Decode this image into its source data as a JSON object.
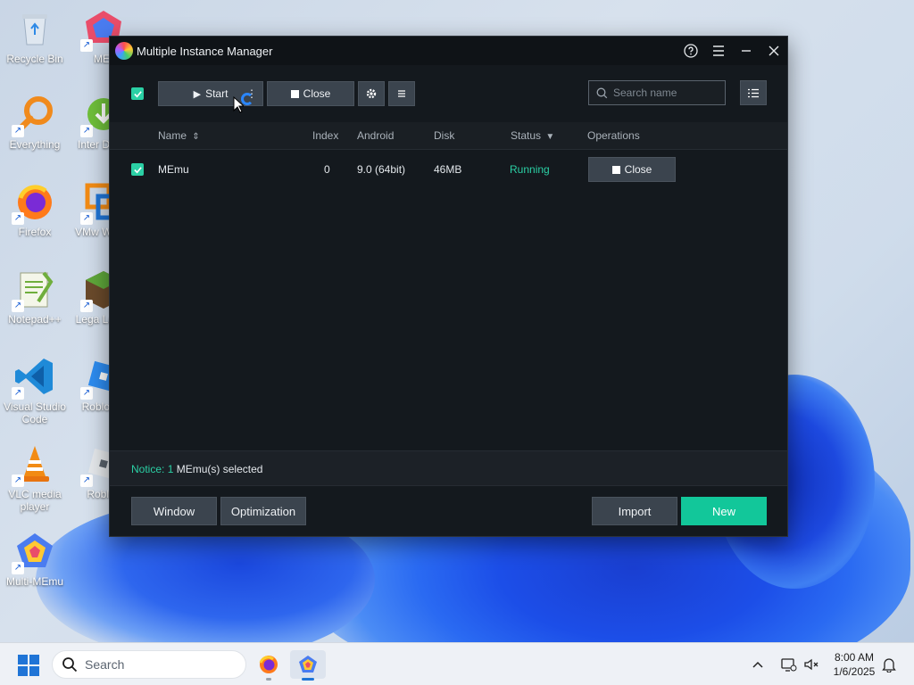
{
  "desktop": {
    "icons": [
      {
        "label": "Recycle Bin"
      },
      {
        "label": "Everything"
      },
      {
        "label": "Firefox"
      },
      {
        "label": "Notepad++"
      },
      {
        "label": "Visual Studio Code"
      },
      {
        "label": "VLC media player"
      },
      {
        "label": "Multi-MEmu"
      },
      {
        "label": "MEr"
      },
      {
        "label": "Inter Down"
      },
      {
        "label": "VMw Works"
      },
      {
        "label": "Lega Launc"
      },
      {
        "label": "Roblox S"
      },
      {
        "label": "Roblox"
      }
    ]
  },
  "window": {
    "title": "Multiple Instance Manager",
    "toolbar": {
      "start_label": "Start",
      "close_label": "Close",
      "search_placeholder": "Search name"
    },
    "table": {
      "headers": {
        "name": "Name",
        "index": "Index",
        "android": "Android",
        "disk": "Disk",
        "status": "Status",
        "operations": "Operations"
      },
      "rows": [
        {
          "name": "MEmu",
          "index": "0",
          "android": "9.0 (64bit)",
          "disk": "46MB",
          "status": "Running",
          "operation": "Close"
        }
      ]
    },
    "notice": {
      "label": "Notice:",
      "count": "1",
      "text": "MEmu(s) selected"
    },
    "footer": {
      "window_label": "Window",
      "optimization_label": "Optimization",
      "import_label": "Import",
      "new_label": "New"
    }
  },
  "taskbar": {
    "search_label": "Search",
    "time": "8:00 AM",
    "date": "1/6/2025"
  },
  "colors": {
    "accent": "#12c79a",
    "running": "#2bd0a5",
    "window_bg": "#14191e"
  }
}
